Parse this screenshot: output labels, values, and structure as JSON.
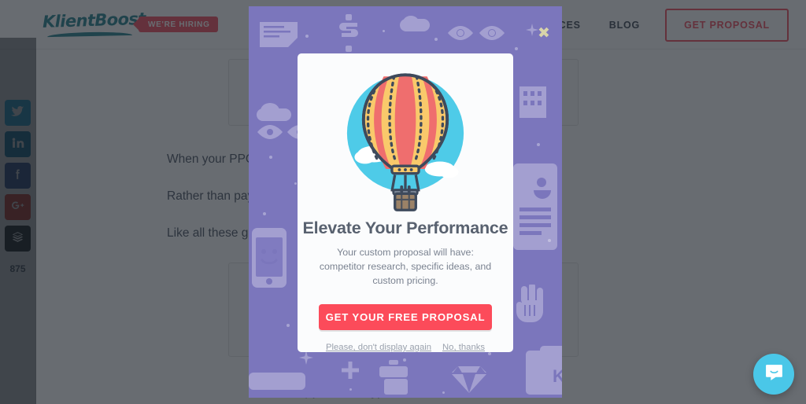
{
  "site": {
    "logo_text": "KlientBoost",
    "hiring_badge": "WE'RE HIRING"
  },
  "nav": {
    "items": [
      {
        "label": "RESOURCES",
        "name": "nav-item-resources"
      },
      {
        "label": "BLOG",
        "name": "nav-item-blog"
      }
    ],
    "cta_label": "GET PROPOSAL"
  },
  "article": {
    "paragraphs": [
      "When your PPC                                  me keywords in your organic SEO",
      "Rather than pay                                  those specific focus keyword t",
      "Like all these gu"
    ],
    "footer_text": "us we will help you to in selling your structured settlement."
  },
  "social": {
    "items": [
      {
        "name": "twitter",
        "icon": "twitter-icon",
        "color": "#2eaadc"
      },
      {
        "name": "linkedin",
        "icon": "linkedin-icon",
        "color": "#1a7fa8"
      },
      {
        "name": "facebook",
        "icon": "facebook-icon",
        "color": "#3b5998"
      },
      {
        "name": "googleplus",
        "icon": "google-plus-icon",
        "color": "#d84134"
      },
      {
        "name": "buffer",
        "icon": "buffer-icon",
        "color": "#2c2c2c"
      }
    ],
    "share_count": "875"
  },
  "modal": {
    "close_label": "✖",
    "title": "Elevate Your Performance",
    "subtitle": "Your custom proposal will have: competitor research, specific ideas, and custom pricing.",
    "cta_label": "GET YOUR FREE PROPOSAL",
    "link_dismiss": "Please, don't display again",
    "link_no_thanks": "No, thanks",
    "illustration": "hot-air-balloon-icon",
    "background_color": "#7b76bc",
    "cta_color": "#fc4b5a"
  },
  "chat": {
    "icon": "chat-bubble-icon",
    "color": "#4ac7e8"
  }
}
